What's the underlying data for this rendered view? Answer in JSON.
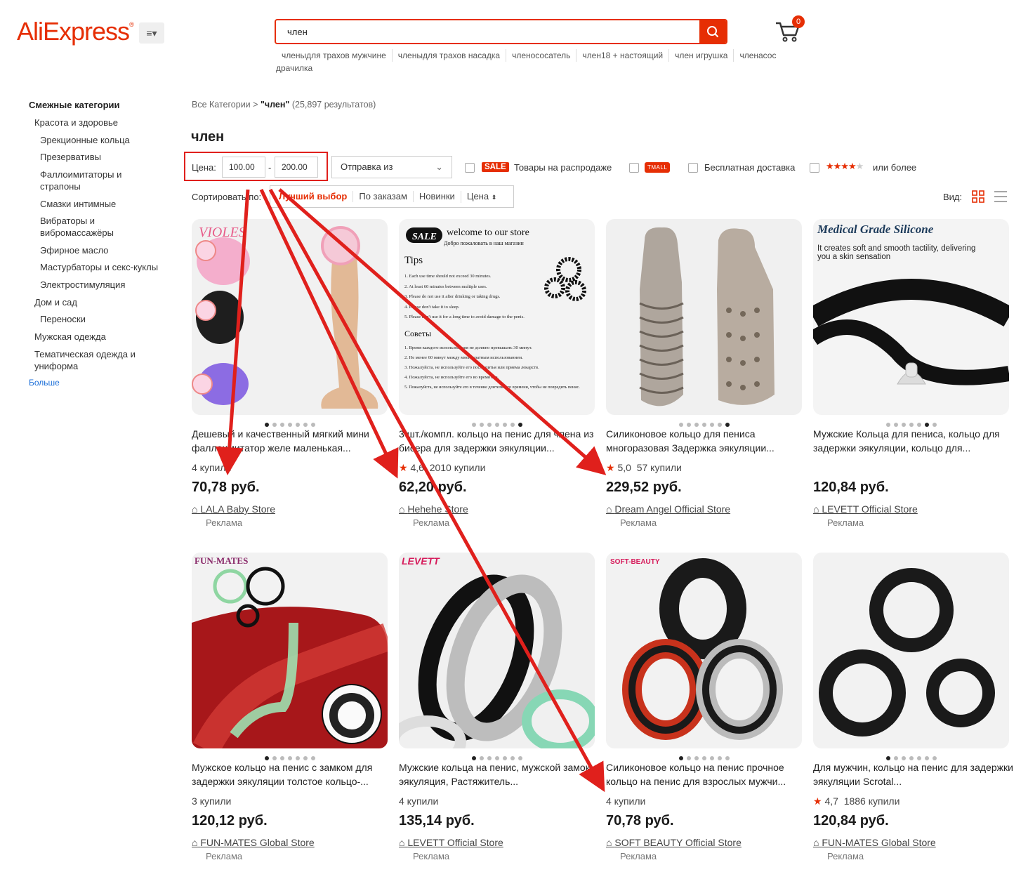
{
  "header": {
    "logo_text": "AliExpress",
    "search_value": "член",
    "hot_searches": [
      "членыдля трахов мужчине",
      "членыдля трахов насадка",
      "членососатель",
      "член18 + настоящий",
      "член игрушка",
      "членасос",
      "драчилка"
    ],
    "cart_count": "0"
  },
  "sidebar": {
    "title": "Смежные категории",
    "items": [
      {
        "label": "Красота и здоровье",
        "level": 1
      },
      {
        "label": "Эрекционные кольца",
        "level": 2
      },
      {
        "label": "Презервативы",
        "level": 2
      },
      {
        "label": "Фаллоимитаторы и страпоны",
        "level": 2
      },
      {
        "label": "Смазки интимные",
        "level": 2
      },
      {
        "label": "Вибраторы и вибромассажёры",
        "level": 2
      },
      {
        "label": "Эфирное масло",
        "level": 2
      },
      {
        "label": "Мастурбаторы и секс-куклы",
        "level": 2
      },
      {
        "label": "Электростимуляция",
        "level": 2
      },
      {
        "label": "Дом и сад",
        "level": 1
      },
      {
        "label": "Переноски",
        "level": 2
      },
      {
        "label": "Мужская одежда",
        "level": 1
      },
      {
        "label": "Тематическая одежда и униформа",
        "level": 1
      }
    ],
    "more": "Больше"
  },
  "breadcrumb": {
    "root": "Все Категории",
    "sep": ">",
    "query": "\"член\"",
    "count": "(25,897 результатов)"
  },
  "query_title": "член",
  "filters": {
    "price_label": "Цена:",
    "price_min": "100.00",
    "price_max": "200.00",
    "dash": "-",
    "ship_from": "Отправка из",
    "sale_badge": "SALE",
    "sale_label": "Товары на распродаже",
    "tmall_badge": "TMALL",
    "free_shipping": "Бесплатная доставка",
    "rating_stars_filled": 4,
    "rating_suffix": "или более"
  },
  "sort": {
    "label": "Сортировать по:",
    "options": [
      "Лучший выбор",
      "По заказам",
      "Новинки",
      "Цена"
    ],
    "active": "Лучший выбор",
    "view_label": "Вид:"
  },
  "products": [
    {
      "title": "Дешевый и качественный мягкий мини фаллоимитатор желе маленькая...",
      "rating": "",
      "sold": "4 купили",
      "price": "70,78 руб.",
      "store": "LALA Baby Store",
      "ad": "Реклама",
      "dots": 7,
      "active_dot": 0
    },
    {
      "title": "3 шт./компл. кольцо на пенис для члена из бисера для задержки эякуляции...",
      "rating": "4,6",
      "sold": "2010 купили",
      "price": "62,20 руб.",
      "store": "Hehehe Store",
      "ad": "Реклама",
      "dots": 7,
      "active_dot": 6
    },
    {
      "title": "Силиконовое кольцо для пениса многоразовая Задержка эякуляции...",
      "rating": "5,0",
      "sold": "57 купили",
      "price": "229,52 руб.",
      "store": "Dream Angel Official Store",
      "ad": "Реклама",
      "dots": 7,
      "active_dot": 6
    },
    {
      "title": "Мужские Кольца для пениса, кольцо для задержки эякуляции, кольцо для...",
      "rating": "",
      "sold": "",
      "price": "120,84 руб.",
      "store": "LEVETT Official Store",
      "ad": "Реклама",
      "dots": 7,
      "active_dot": 5
    },
    {
      "title": "Мужское кольцо на пенис с замком для задержки эякуляции толстое кольцо-...",
      "rating": "",
      "sold": "3 купили",
      "price": "120,12 руб.",
      "store": "FUN-MATES Global Store",
      "ad": "Реклама",
      "dots": 7,
      "active_dot": 0
    },
    {
      "title": "Мужские кольца на пенис, мужской замок, эякуляция, Растяжитель...",
      "rating": "",
      "sold": "4 купили",
      "price": "135,14 руб.",
      "store": "LEVETT Official Store",
      "ad": "Реклама",
      "dots": 7,
      "active_dot": 0
    },
    {
      "title": "Силиконовое кольцо на пенис прочное кольцо на пенис для взрослых мужчи...",
      "rating": "",
      "sold": "4 купили",
      "price": "70,78 руб.",
      "store": "SOFT BEAUTY Official Store",
      "ad": "Реклама",
      "dots": 7,
      "active_dot": 0
    },
    {
      "title": "Для мужчин, кольцо на пенис для задержки эякуляции Scrotal...",
      "rating": "4,7",
      "sold": "1886 купили",
      "price": "120,84 руб.",
      "store": "FUN-MATES Global Store",
      "ad": "Реклама",
      "dots": 7,
      "active_dot": 0
    }
  ],
  "image_texts": {
    "p1_brand": "VIOLES",
    "p2_sale": "SALE",
    "p2_welcome": "welcome to our store",
    "p2_welcome_ru": "Добро пожаловать в наш магазин",
    "p2_tips": "Tips",
    "p2_tips_list": [
      "1. Each use time should not exceed 30 minutes.",
      "2. At least 60 minutes between multiple uses.",
      "3. Please do not use it after drinking or taking drugs.",
      "4. Please don't take it to sleep.",
      "5. Please don't use it for a long time to avoid damage to the penis."
    ],
    "p2_sovety": "Советы",
    "p2_sovety_list": [
      "1. Время каждого использования не должно превышать 30 минут.",
      "2. Не менее 60 минут между многократным использованием.",
      "3. Пожалуйста, не используйте его после питья или приема лекарств.",
      "4. Пожалуйста, не используйте его во время сна.",
      "5. Пожалуйста, не используйте его в течение длительного времени, чтобы не повредить пенис."
    ],
    "p4_heading": "Medical Grade Silicone",
    "p4_sub": "It creates soft and smooth tactility, delivering you a skin sensation",
    "p5_brand": "FUN-MATES",
    "p6_brand": "LEVETT",
    "p7_brand": "SOFT-BEAUTY"
  },
  "colors": {
    "accent": "#e62e04",
    "annotation": "#e0201c"
  }
}
